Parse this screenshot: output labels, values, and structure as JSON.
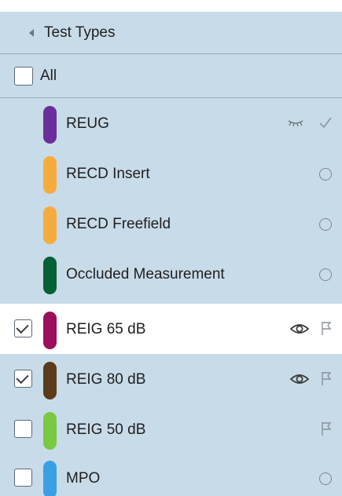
{
  "header": {
    "title": "Test Types",
    "collapse_icon": "caret-left-icon"
  },
  "all_row": {
    "label": "All",
    "checked": false
  },
  "items": [
    {
      "label": "REUG",
      "color": "#6a2f9a",
      "checkbox": false,
      "checked": false,
      "status_icons": [
        "eye-closed-icon",
        "checkmark-icon"
      ],
      "selected": false
    },
    {
      "label": "RECD Insert",
      "color": "#f5ac3d",
      "checkbox": false,
      "checked": false,
      "status_icons": [
        "circle-icon"
      ],
      "selected": false
    },
    {
      "label": "RECD Freefield",
      "color": "#f5ac3d",
      "checkbox": false,
      "checked": false,
      "status_icons": [
        "circle-icon"
      ],
      "selected": false
    },
    {
      "label": "Occluded Measurement",
      "color": "#075f36",
      "checkbox": false,
      "checked": false,
      "status_icons": [
        "circle-icon"
      ],
      "selected": false
    },
    {
      "label": "REIG 65 dB",
      "color": "#9c0f5c",
      "checkbox": true,
      "checked": true,
      "status_icons": [
        "eye-icon",
        "flag-icon"
      ],
      "selected": true
    },
    {
      "label": "REIG 80 dB",
      "color": "#5a3c1a",
      "checkbox": true,
      "checked": true,
      "status_icons": [
        "eye-icon",
        "flag-icon"
      ],
      "selected": false
    },
    {
      "label": "REIG 50 dB",
      "color": "#7ac943",
      "checkbox": true,
      "checked": false,
      "status_icons": [
        "flag-icon"
      ],
      "selected": false
    },
    {
      "label": "MPO",
      "color": "#3aa0e4",
      "checkbox": true,
      "checked": false,
      "status_icons": [
        "circle-icon"
      ],
      "selected": false
    }
  ]
}
